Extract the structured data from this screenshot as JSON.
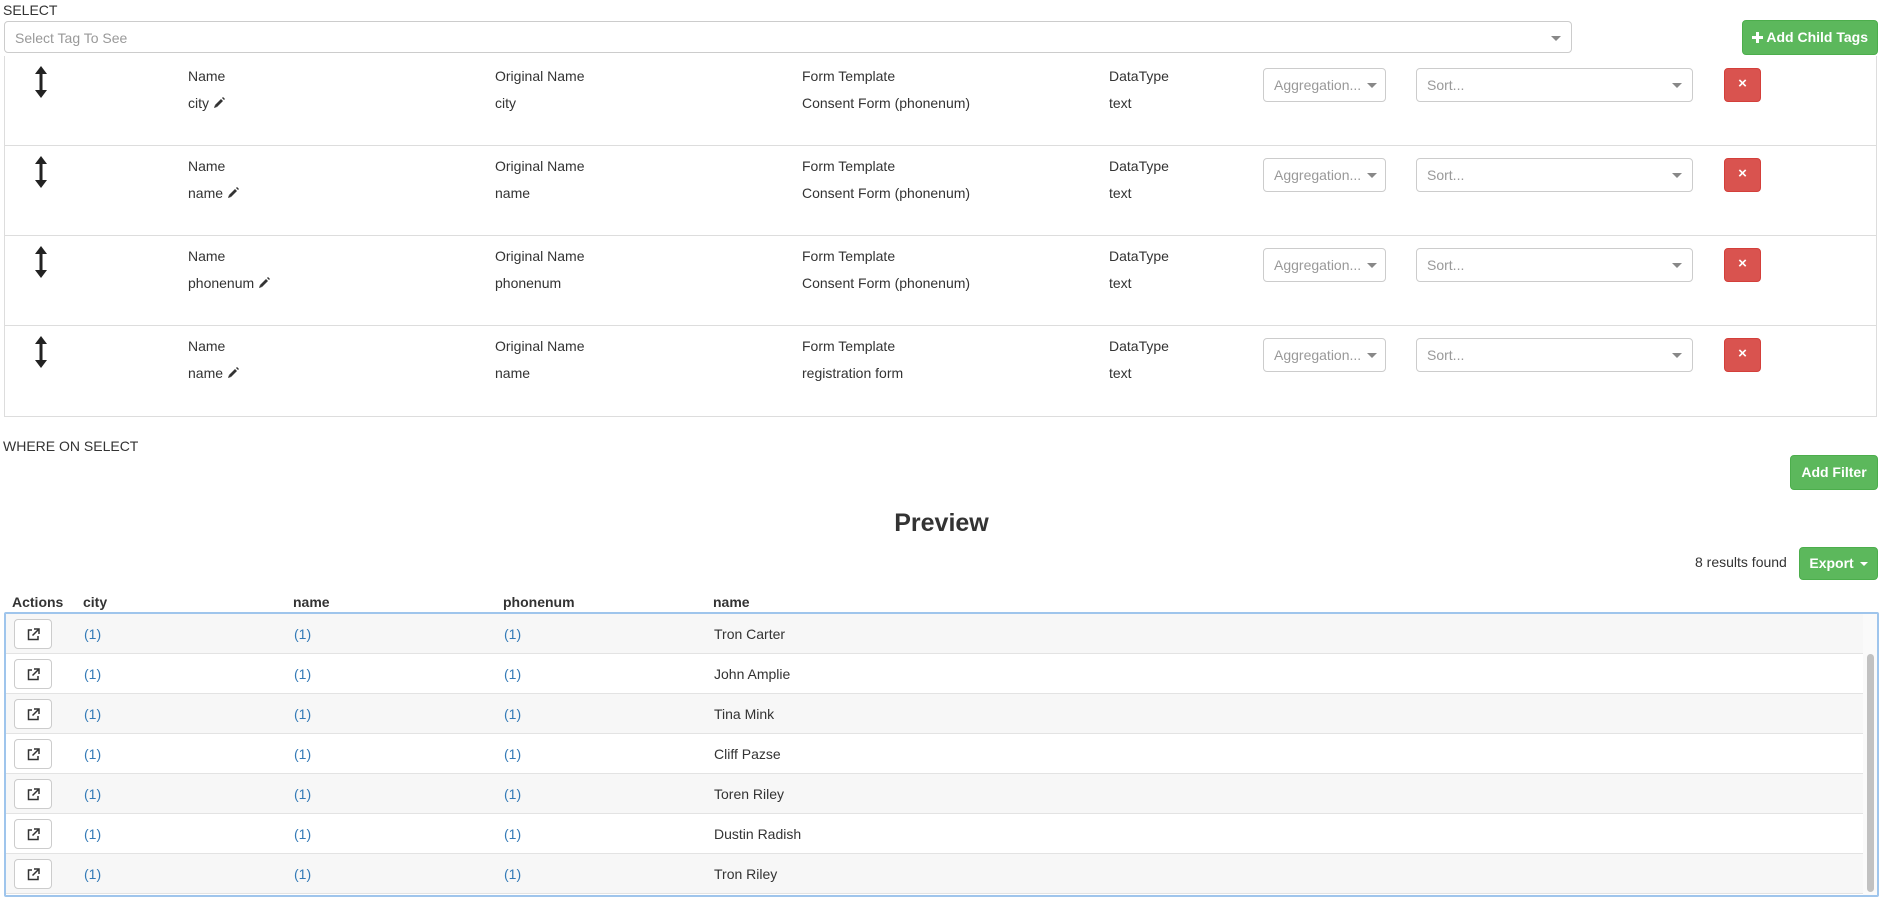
{
  "select": {
    "section_label": "SELECT",
    "tag_placeholder": "Select Tag To See",
    "add_child_tags_label": "Add Child Tags"
  },
  "tag_columns": {
    "name": "Name",
    "original_name": "Original Name",
    "form_template": "Form Template",
    "datatype": "DataType"
  },
  "tags": [
    {
      "name": "city",
      "original_name": "city",
      "form_template": "Consent Form (phonenum)",
      "datatype": "text",
      "aggregation_placeholder": "Aggregation...",
      "sort_placeholder": "Sort...",
      "remove_label": "×"
    },
    {
      "name": "name",
      "original_name": "name",
      "form_template": "Consent Form (phonenum)",
      "datatype": "text",
      "aggregation_placeholder": "Aggregation...",
      "sort_placeholder": "Sort...",
      "remove_label": "×"
    },
    {
      "name": "phonenum",
      "original_name": "phonenum",
      "form_template": "Consent Form (phonenum)",
      "datatype": "text",
      "aggregation_placeholder": "Aggregation...",
      "sort_placeholder": "Sort...",
      "remove_label": "×"
    },
    {
      "name": "name",
      "original_name": "name",
      "form_template": "registration form",
      "datatype": "text",
      "aggregation_placeholder": "Aggregation...",
      "sort_placeholder": "Sort...",
      "remove_label": "×"
    }
  ],
  "where": {
    "section_label": "WHERE ON SELECT",
    "add_filter_label": "Add Filter"
  },
  "preview": {
    "title": "Preview",
    "results_text": "8 results found",
    "export_label": "Export",
    "columns": [
      "Actions",
      "city",
      "name",
      "phonenum",
      "name"
    ],
    "rows": [
      {
        "city": "(1)",
        "name": "(1)",
        "phonenum": "(1)",
        "name2": "Tron Carter"
      },
      {
        "city": "(1)",
        "name": "(1)",
        "phonenum": "(1)",
        "name2": "John Amplie"
      },
      {
        "city": "(1)",
        "name": "(1)",
        "phonenum": "(1)",
        "name2": "Tina Mink"
      },
      {
        "city": "(1)",
        "name": "(1)",
        "phonenum": "(1)",
        "name2": "Cliff Pazse"
      },
      {
        "city": "(1)",
        "name": "(1)",
        "phonenum": "(1)",
        "name2": "Toren Riley"
      },
      {
        "city": "(1)",
        "name": "(1)",
        "phonenum": "(1)",
        "name2": "Dustin Radish"
      },
      {
        "city": "(1)",
        "name": "(1)",
        "phonenum": "(1)",
        "name2": "Tron Riley"
      }
    ]
  },
  "icons": {
    "drag": "vertical-arrows-icon",
    "edit": "pencil-icon",
    "remove": "close-icon",
    "open": "external-link-icon",
    "add": "plus-icon",
    "dropdown": "caret-down-icon"
  },
  "colors": {
    "success": "#5cb85c",
    "danger": "#d9534f",
    "link": "#337ab7",
    "focus_border": "#9fc5ec"
  }
}
